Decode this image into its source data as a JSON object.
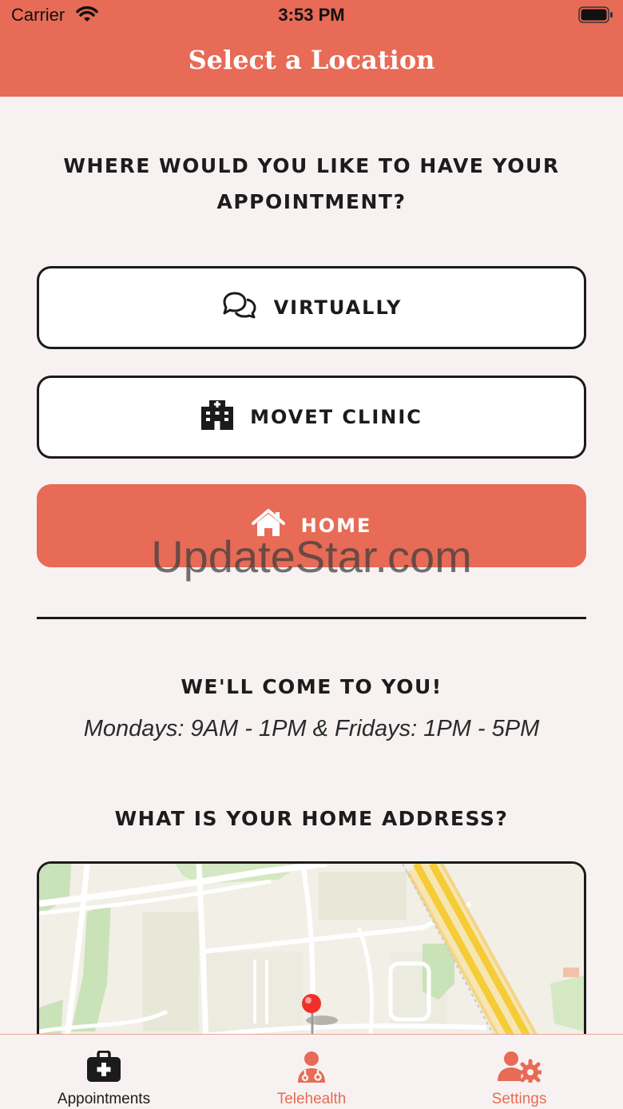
{
  "status_bar": {
    "carrier": "Carrier",
    "time": "3:53 PM"
  },
  "nav": {
    "title": "Select a Location"
  },
  "question": "WHERE WOULD YOU LIKE TO HAVE YOUR APPOINTMENT?",
  "options": {
    "virtually": {
      "label": "VIRTUALLY",
      "icon": "chat-bubbles-icon"
    },
    "clinic": {
      "label": "MOVET CLINIC",
      "icon": "hospital-icon"
    },
    "home": {
      "label": "HOME",
      "icon": "house-icon",
      "selected": true
    }
  },
  "watermark": "UpdateStar.com",
  "home_info": {
    "title": "WE'LL COME TO YOU!",
    "hours": "Mondays: 9AM - 1PM & Fridays: 1PM - 5PM"
  },
  "address_prompt": "WHAT IS YOUR HOME ADDRESS?",
  "tabs": [
    {
      "label": "Appointments",
      "icon": "medical-kit-icon",
      "active": true
    },
    {
      "label": "Telehealth",
      "icon": "doctor-icon",
      "active": false
    },
    {
      "label": "Settings",
      "icon": "user-settings-icon",
      "active": false
    }
  ],
  "colors": {
    "accent": "#e76b56",
    "dark": "#1b1b1b",
    "background": "#f7f2f1"
  }
}
